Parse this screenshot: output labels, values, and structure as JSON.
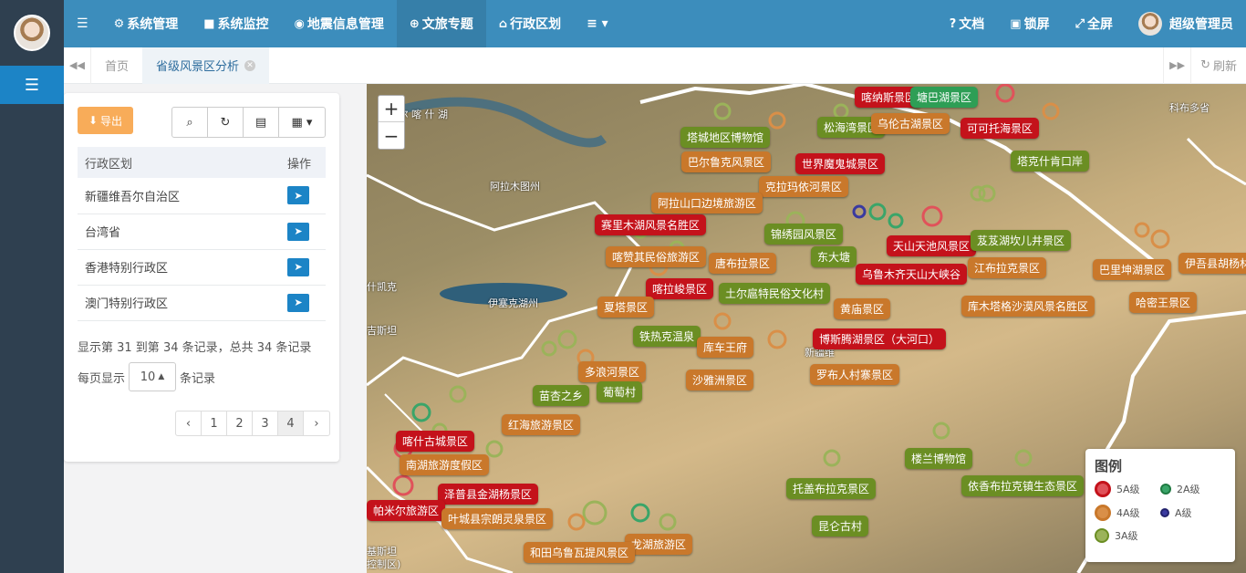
{
  "topnav": {
    "items": [
      {
        "label": "系统管理",
        "icon": "gear-icon"
      },
      {
        "label": "系统监控",
        "icon": "video-camera-icon"
      },
      {
        "label": "地震信息管理",
        "icon": "map-marker-icon"
      },
      {
        "label": "文旅专题",
        "icon": "globe-icon"
      },
      {
        "label": "行政区划",
        "icon": "bank-icon"
      }
    ],
    "right": [
      {
        "label": "文档",
        "icon": "question-icon"
      },
      {
        "label": "锁屏",
        "icon": "lock-icon"
      },
      {
        "label": "全屏",
        "icon": "expand-icon"
      },
      {
        "label": "超级管理员",
        "icon": "avatar"
      }
    ]
  },
  "tabs": {
    "home": "首页",
    "active": "省级风景区分析",
    "refresh": "刷新"
  },
  "toolbar": {
    "export": "导出"
  },
  "table": {
    "headers": [
      "行政区划",
      "操作"
    ],
    "rows": [
      "新疆维吾尔自治区",
      "台湾省",
      "香港特别行政区",
      "澳门特别行政区"
    ]
  },
  "pagination": {
    "info": "显示第 31 到第 34 条记录，总共 34 条记录",
    "per_page_prefix": "每页显示",
    "per_page_value": "10",
    "per_page_suffix": "条记录",
    "pages": [
      "‹",
      "1",
      "2",
      "3",
      "4",
      "›"
    ],
    "current": "4"
  },
  "map": {
    "geo_labels": [
      "乌 尔 喀 什 湖",
      "阿拉木图州",
      "伊塞克湖州",
      "科布多省",
      "什凯克",
      "吉斯坦",
      "基斯坦",
      "控制区)",
      "新疆维"
    ],
    "labels": [
      {
        "t": "喀纳斯景区",
        "c": "c5"
      },
      {
        "t": "塘巴湖景区",
        "c": "c2"
      },
      {
        "t": "松海湾景区",
        "c": "c3"
      },
      {
        "t": "乌伦古湖景区",
        "c": "c4"
      },
      {
        "t": "可可托海景区",
        "c": "c5"
      },
      {
        "t": "塔城地区博物馆",
        "c": "c3"
      },
      {
        "t": "巴尔鲁克风景区",
        "c": "c4"
      },
      {
        "t": "世界魔鬼城景区",
        "c": "c5"
      },
      {
        "t": "塔克什肯口岸",
        "c": "c3"
      },
      {
        "t": "克拉玛依河景区",
        "c": "c4"
      },
      {
        "t": "阿拉山口边境旅游区",
        "c": "c4"
      },
      {
        "t": "赛里木湖风景名胜区",
        "c": "c5"
      },
      {
        "t": "锦绣园风景区",
        "c": "c3"
      },
      {
        "t": "天山天池风景区",
        "c": "c5"
      },
      {
        "t": "芨芨湖坎儿井景区",
        "c": "c3"
      },
      {
        "t": "喀赞其民俗旅游区",
        "c": "c4"
      },
      {
        "t": "唐布拉景区",
        "c": "c4"
      },
      {
        "t": "东大塘",
        "c": "c3"
      },
      {
        "t": "乌鲁木齐天山大峡谷",
        "c": "c5"
      },
      {
        "t": "江布拉克景区",
        "c": "c4"
      },
      {
        "t": "巴里坤湖景区",
        "c": "c4"
      },
      {
        "t": "伊吾县胡杨林生",
        "c": "c4"
      },
      {
        "t": "喀拉峻景区",
        "c": "c5"
      },
      {
        "t": "土尔扈特民俗文化村",
        "c": "c3"
      },
      {
        "t": "夏塔景区",
        "c": "c4"
      },
      {
        "t": "黄庙景区",
        "c": "c4"
      },
      {
        "t": "库木塔格沙漠风景名胜区",
        "c": "c4"
      },
      {
        "t": "哈密王景区",
        "c": "c4"
      },
      {
        "t": "铁热克温泉",
        "c": "c3"
      },
      {
        "t": "库车王府",
        "c": "c4"
      },
      {
        "t": "博斯腾湖景区（大河口）",
        "c": "c5"
      },
      {
        "t": "多浪河景区",
        "c": "c4"
      },
      {
        "t": "沙雅洲景区",
        "c": "c4"
      },
      {
        "t": "罗布人村寨景区",
        "c": "c4"
      },
      {
        "t": "葡萄村",
        "c": "c3"
      },
      {
        "t": "苗杏之乡",
        "c": "c3"
      },
      {
        "t": "红海旅游景区",
        "c": "c4"
      },
      {
        "t": "喀什古城景区",
        "c": "c5"
      },
      {
        "t": "楼兰博物馆",
        "c": "c3"
      },
      {
        "t": "南湖旅游度假区",
        "c": "c4"
      },
      {
        "t": "依香布拉克镇生态景区",
        "c": "c3"
      },
      {
        "t": "泽普县金湖杨景区",
        "c": "c5"
      },
      {
        "t": "托盖布拉克景区",
        "c": "c3"
      },
      {
        "t": "帕米尔旅游区",
        "c": "c5"
      },
      {
        "t": "叶城县宗朗灵泉景区",
        "c": "c4"
      },
      {
        "t": "昆仑古村",
        "c": "c3"
      },
      {
        "t": "龙湖旅游区",
        "c": "c4"
      },
      {
        "t": "和田乌鲁瓦提风景区",
        "c": "c4"
      }
    ]
  },
  "legend": {
    "title": "图例",
    "items": [
      {
        "label": "5A级",
        "color": "#e0525a"
      },
      {
        "label": "2A级",
        "color": "#3aa569"
      },
      {
        "label": "4A级",
        "color": "#d98f48"
      },
      {
        "label": "A级",
        "color": "#3a3aa0"
      },
      {
        "label": "3A级",
        "color": "#9bb35a"
      }
    ]
  }
}
